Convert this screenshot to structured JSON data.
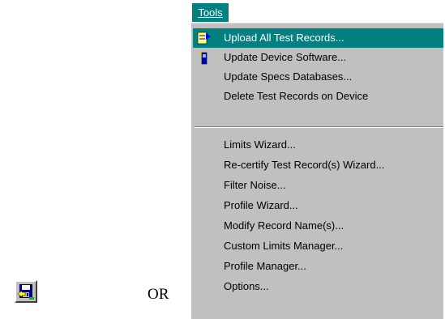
{
  "toolbar_button": {
    "icon": "save-upload-icon"
  },
  "or_text": "OR",
  "menu": {
    "title": "Tools",
    "items": [
      {
        "label": "Upload All Test Records...",
        "icon": "upload-records-icon",
        "highlighted": true
      },
      {
        "label": "Update Device Software...",
        "icon": "update-software-icon",
        "highlighted": false
      },
      {
        "label": "Update Specs Databases...",
        "highlighted": false
      },
      {
        "label": "Delete Test Records on Device",
        "highlighted": false
      },
      {
        "label": "Limits Wizard...",
        "highlighted": false
      },
      {
        "label": "Re-certify Test Record(s) Wizard...",
        "highlighted": false
      },
      {
        "label": "Filter Noise...",
        "highlighted": false
      },
      {
        "label": "Profile Wizard...",
        "highlighted": false
      },
      {
        "label": "Modify Record Name(s)...",
        "highlighted": false
      },
      {
        "label": "Custom Limits Manager...",
        "highlighted": false
      },
      {
        "label": "Profile Manager...",
        "highlighted": false
      },
      {
        "label": "Options...",
        "highlighted": false
      }
    ],
    "highlight_color": "#008080",
    "menu_background": "#c0c0c0"
  }
}
